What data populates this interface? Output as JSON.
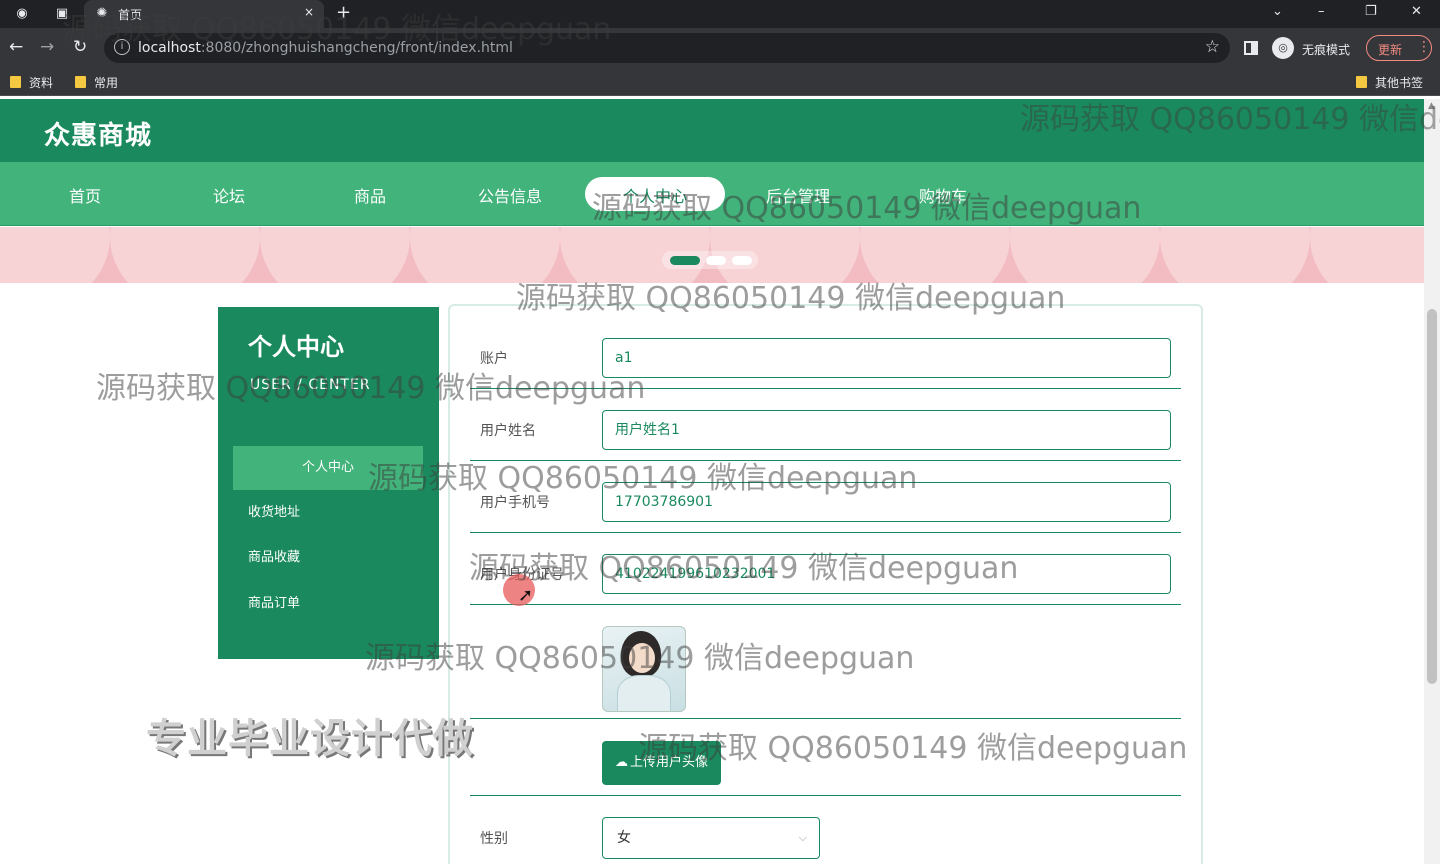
{
  "browser": {
    "tab_title": "首页",
    "tab_close": "×",
    "new_tab": "+",
    "window_controls": [
      "⌄",
      "–",
      "❐",
      "✕"
    ],
    "nav_buttons": [
      "←",
      "→",
      "↻"
    ],
    "url_host": "localhost",
    "url_path": ":8080/zhonghuishangcheng/front/index.html",
    "incognito_label": "无痕模式",
    "update_label": "更新",
    "bookmarks": [
      "资料",
      "常用"
    ],
    "other_bookmarks": "其他书签"
  },
  "site": {
    "logo": "众惠商城",
    "nav": [
      "首页",
      "论坛",
      "商品",
      "公告信息",
      "个人中心",
      "后台管理",
      "购物车"
    ],
    "active_nav": "个人中心"
  },
  "sidebar": {
    "title": "个人中心",
    "subtitle": "USER / CENTER",
    "items": [
      "个人中心",
      "收货地址",
      "商品收藏",
      "商品订单"
    ]
  },
  "form": {
    "account_label": "账户",
    "account_value": "a1",
    "name_label": "用户姓名",
    "name_value": "用户姓名1",
    "phone_label": "用户手机号",
    "phone_value": "17703786901",
    "idcard_label": "用户身份证号",
    "idcard_value": "410224199610232001",
    "upload_button": "上传用户头像",
    "gender_label": "性别",
    "gender_value": "女"
  },
  "overlay": {
    "promo": "专业毕业设计代做",
    "watermark": "源码获取 QQ86050149 微信deepguan"
  },
  "colors": {
    "brand_dark": "#1a8a5e",
    "brand_light": "#42b37b",
    "banner_pink": "#f2bcc2"
  }
}
